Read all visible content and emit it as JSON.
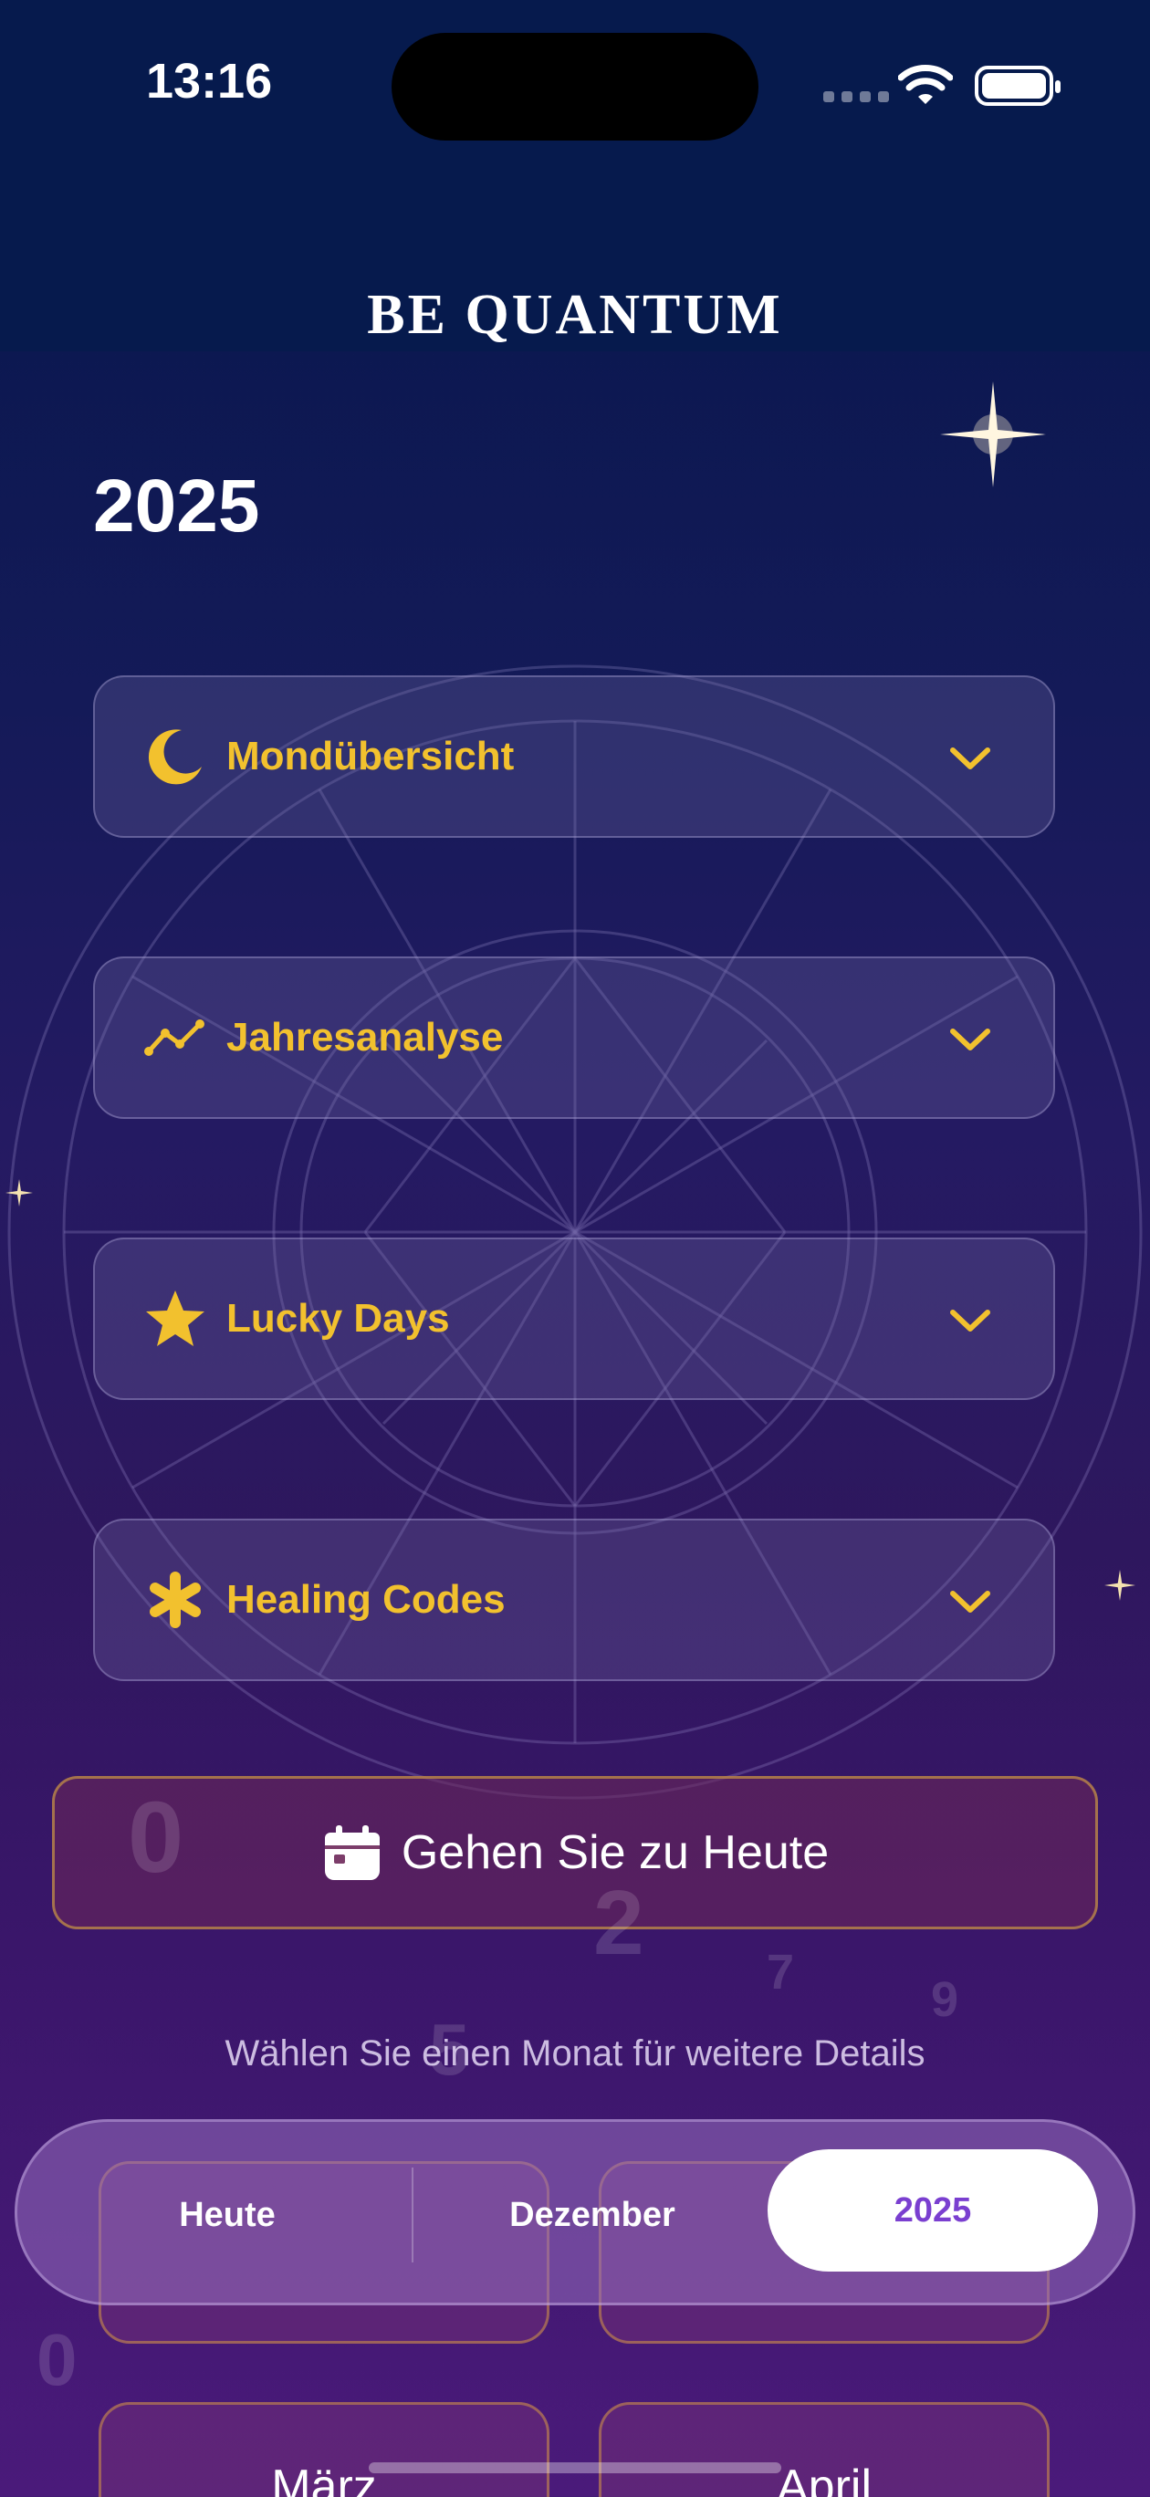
{
  "status_bar": {
    "time": "13:16"
  },
  "brand": {
    "title": "BE QUANTUM"
  },
  "page": {
    "year_title": "2025"
  },
  "accordions": [
    {
      "label": "Mondübersicht",
      "icon": "moon-icon"
    },
    {
      "label": "Jahresanalyse",
      "icon": "trend-icon"
    },
    {
      "label": "Lucky Days",
      "icon": "star-icon"
    },
    {
      "label": "Healing Codes",
      "icon": "asterisk-icon"
    }
  ],
  "today_button": {
    "label": "Gehen Sie zu Heute",
    "icon": "calendar-icon"
  },
  "hint": "Wählen Sie einen Monat für weitere Details",
  "months": [
    "März",
    "April"
  ],
  "tabbar": {
    "tabs": [
      "Heute",
      "Dezember",
      "2025"
    ],
    "active": "2025"
  },
  "colors": {
    "accent_gold": "#f2c12e",
    "active_tab_text": "#7a3fd0"
  }
}
